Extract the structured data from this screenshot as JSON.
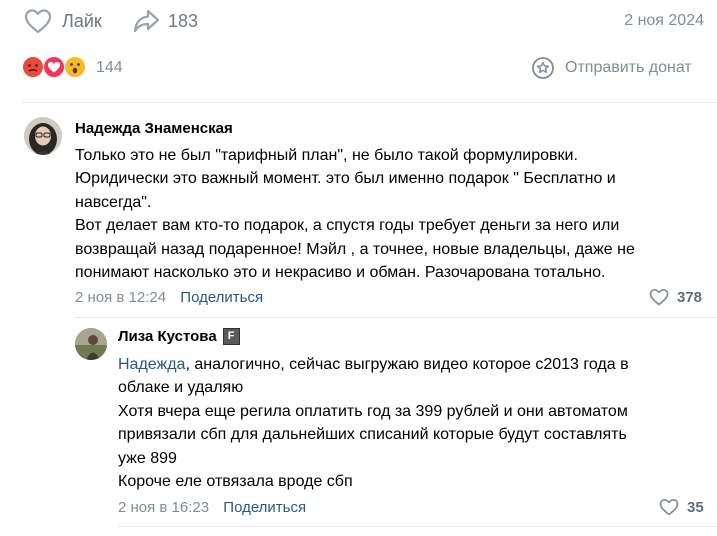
{
  "post_actions": {
    "like_label": "Лайк",
    "share_count": "183",
    "date": "2 ноя 2024"
  },
  "reactions": {
    "count": "144",
    "donate_label": "Отправить донат"
  },
  "comments": [
    {
      "author": "Надежда Знаменская",
      "lines": [
        "Только это не был \"тарифный план\", не было такой формулировки.",
        "Юридически это важный момент. это был именно подарок \" Бесплатно и",
        "навсегда\".",
        "Вот делает вам кто-то подарок, а спустя годы требует деньги за него или",
        "возвращай назад подаренное! Мэйл , а точнее, новые владельцы, даже не",
        "понимают насколько это и некрасиво и обман. Разочарована тотально."
      ],
      "time": "2 ноя в 12:24",
      "share_label": "Поделиться",
      "likes": "378"
    },
    {
      "author": "Лиза Кустова",
      "badge": "F",
      "reply_to": "Надежда",
      "first_line_rest": ", аналогично, сейчас выгружаю видео которое с2013 года в",
      "lines": [
        "облаке и удаляю",
        "Хотя вчера еще регила оплатить год за 399 рублей и они автоматом",
        "привязали сбп для дальнейших списаний которые будут составлять",
        "уже 899",
        "Короче еле отвязала вроде сбп"
      ],
      "time": "2 ноя в 16:23",
      "share_label": "Поделиться",
      "likes": "35"
    }
  ]
}
